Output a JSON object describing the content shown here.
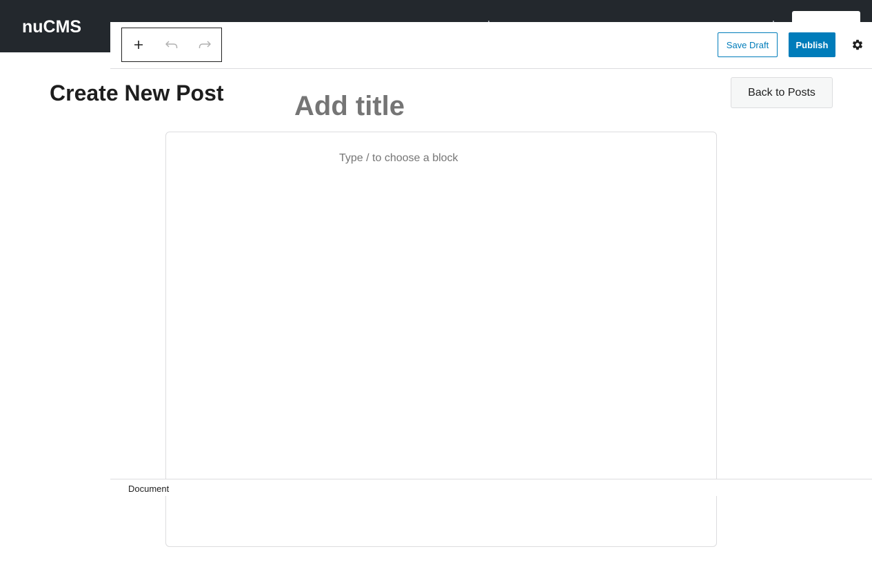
{
  "header": {
    "brand": "nuCMS"
  },
  "page": {
    "title": "Create New Post",
    "back_label": "Back to Posts"
  },
  "toolbar": {
    "add_icon": "plus-icon",
    "undo_icon": "undo-icon",
    "redo_icon": "redo-icon",
    "save_draft_label": "Save Draft",
    "publish_label": "Publish",
    "settings_icon": "gear-icon"
  },
  "editor": {
    "title_placeholder": "Add title",
    "block_placeholder": "Type / to choose a block"
  },
  "footer": {
    "breadcrumb": "Document"
  },
  "colors": {
    "topbar": "#23282d",
    "accent": "#007cba",
    "placeholder": "#757575",
    "border": "#dcdcde"
  }
}
